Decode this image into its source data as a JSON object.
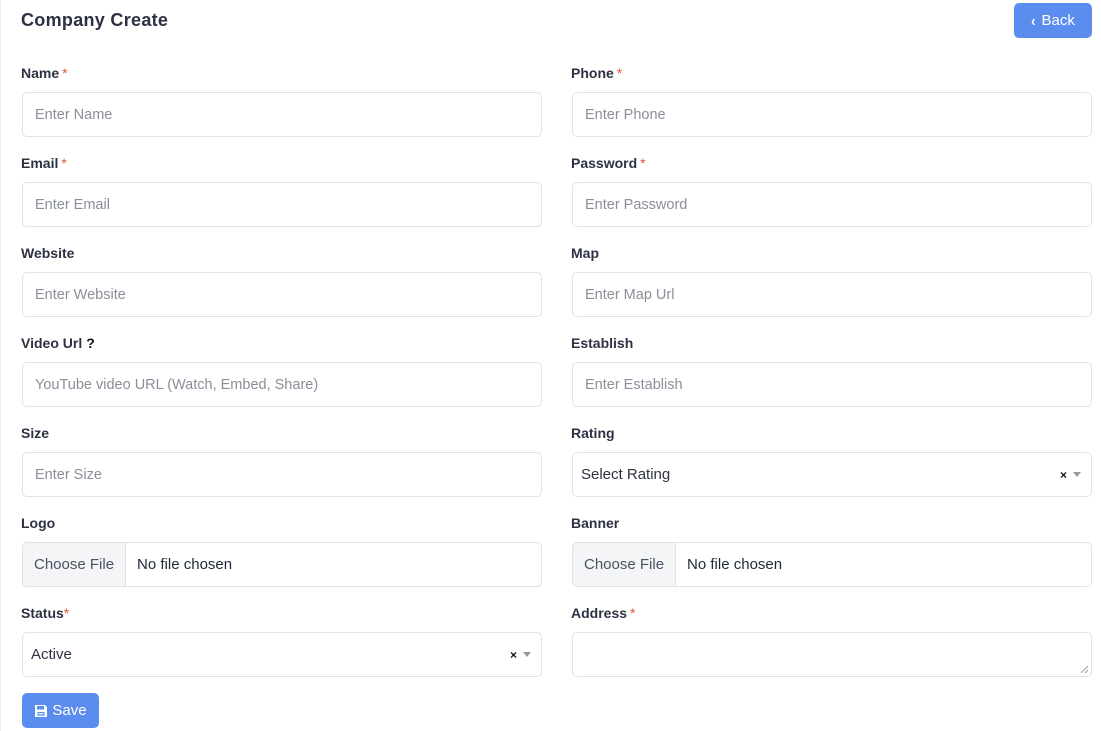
{
  "header": {
    "title": "Company Create",
    "back_label": "Back"
  },
  "fields": {
    "name": {
      "label": "Name",
      "required": "*",
      "placeholder": "Enter Name"
    },
    "phone": {
      "label": "Phone",
      "required": "*",
      "placeholder": "Enter Phone"
    },
    "email": {
      "label": "Email",
      "required": "*",
      "placeholder": "Enter Email"
    },
    "password": {
      "label": "Password",
      "required": "*",
      "placeholder": "Enter Password"
    },
    "website": {
      "label": "Website",
      "placeholder": "Enter Website"
    },
    "map": {
      "label": "Map",
      "placeholder": "Enter Map Url"
    },
    "video_url": {
      "label": "Video Url",
      "help": "?",
      "placeholder": "YouTube video URL (Watch, Embed, Share)"
    },
    "establish": {
      "label": "Establish",
      "placeholder": "Enter Establish"
    },
    "size": {
      "label": "Size",
      "placeholder": "Enter Size"
    },
    "rating": {
      "label": "Rating",
      "value": "Select Rating",
      "clear": "×"
    },
    "logo": {
      "label": "Logo",
      "button": "Choose File",
      "status": "No file chosen"
    },
    "banner": {
      "label": "Banner",
      "button": "Choose File",
      "status": "No file chosen"
    },
    "status": {
      "label": "Status",
      "required": "*",
      "value": "Active",
      "clear": "×"
    },
    "address": {
      "label": "Address",
      "required": "*"
    }
  },
  "actions": {
    "save_label": "Save"
  },
  "colors": {
    "primary": "#5b8def",
    "required": "#e5533d",
    "border": "#dfe2e8"
  }
}
